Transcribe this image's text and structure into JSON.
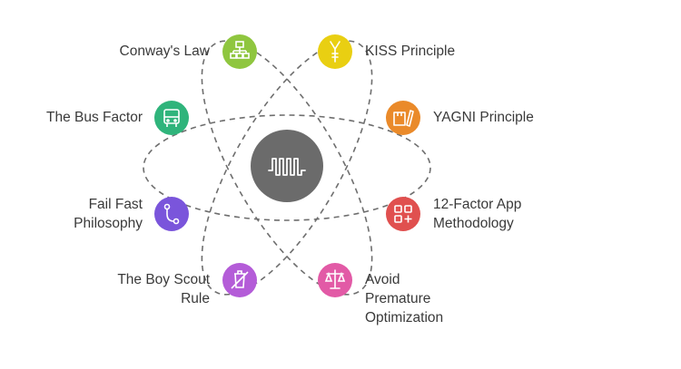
{
  "center": {
    "icon": "waveform-icon",
    "color": "#6b6b6b"
  },
  "nodes": [
    {
      "id": "conways-law",
      "label": "Conway's Law",
      "color": "#8fc63f",
      "icon": "org-chart-icon"
    },
    {
      "id": "kiss-principle",
      "label": "KISS Principle",
      "color": "#e9cf12",
      "icon": "kiss-icon"
    },
    {
      "id": "bus-factor",
      "label": "The Bus Factor",
      "color": "#2fb47b",
      "icon": "bus-icon"
    },
    {
      "id": "yagni-principle",
      "label": "YAGNI Principle",
      "color": "#ea8a2a",
      "icon": "ruler-pencil-icon"
    },
    {
      "id": "fail-fast",
      "label": "Fail Fast\nPhilosophy",
      "color": "#7a55db",
      "icon": "git-branch-icon"
    },
    {
      "id": "twelve-factor",
      "label": "12-Factor App\nMethodology",
      "color": "#e0504f",
      "icon": "grid-plus-icon"
    },
    {
      "id": "boy-scout",
      "label": "The Boy Scout\nRule",
      "color": "#b45cd8",
      "icon": "no-trash-icon"
    },
    {
      "id": "premature-optimization",
      "label": "Avoid\nPremature\nOptimization",
      "color": "#e25aa6",
      "icon": "scale-icon"
    }
  ]
}
